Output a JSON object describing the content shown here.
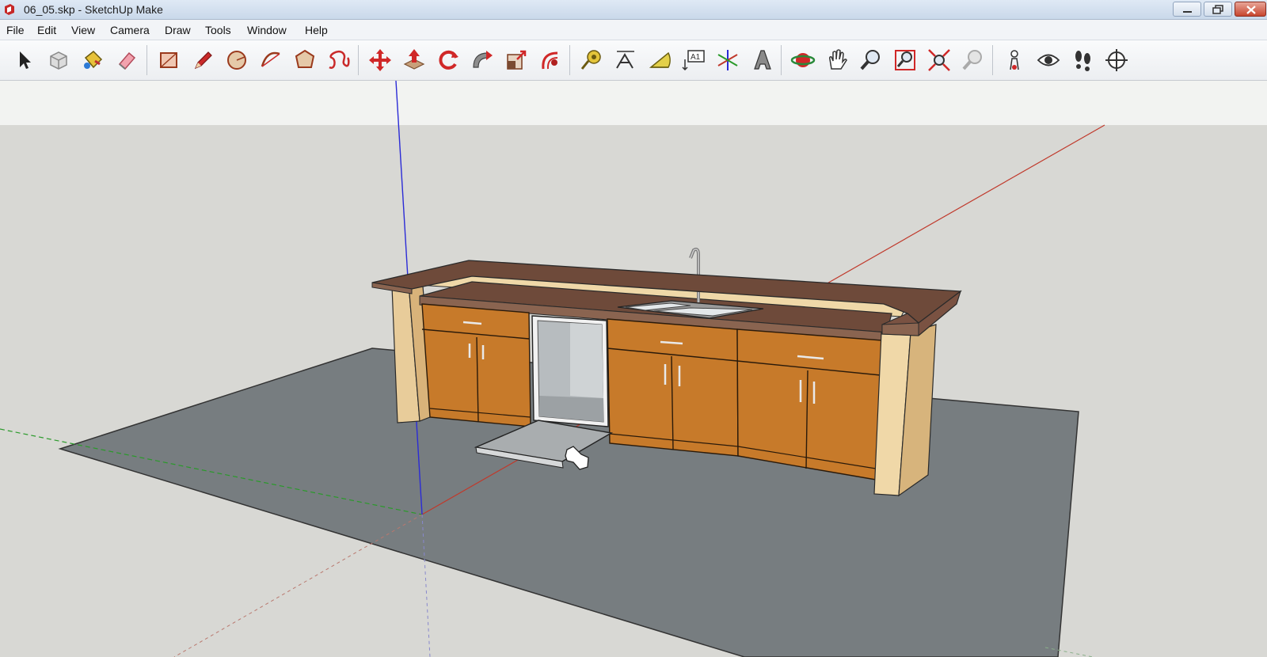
{
  "window": {
    "title": "06_05.skp - SketchUp Make"
  },
  "menu": [
    "File",
    "Edit",
    "View",
    "Camera",
    "Draw",
    "Tools",
    "Window",
    "Help"
  ],
  "toolbar": {
    "tools": [
      {
        "name": "select-tool",
        "icon": "arrow-cursor-icon"
      },
      {
        "name": "make-component-tool",
        "icon": "component-icon"
      },
      {
        "name": "paint-bucket-tool",
        "icon": "paint-bucket-icon"
      },
      {
        "name": "eraser-tool",
        "icon": "eraser-icon"
      },
      {
        "name": "rectangle-tool",
        "icon": "rectangle-icon"
      },
      {
        "name": "line-tool",
        "icon": "pencil-icon"
      },
      {
        "name": "circle-tool",
        "icon": "circle-icon"
      },
      {
        "name": "arc-tool",
        "icon": "arc-icon"
      },
      {
        "name": "polygon-tool",
        "icon": "polygon-icon"
      },
      {
        "name": "freehand-tool",
        "icon": "freehand-icon"
      },
      {
        "name": "move-tool",
        "icon": "move-icon"
      },
      {
        "name": "push-pull-tool",
        "icon": "push-pull-icon"
      },
      {
        "name": "rotate-tool",
        "icon": "rotate-icon"
      },
      {
        "name": "follow-me-tool",
        "icon": "follow-me-icon"
      },
      {
        "name": "scale-tool",
        "icon": "scale-icon"
      },
      {
        "name": "offset-tool",
        "icon": "offset-icon"
      },
      {
        "name": "tape-measure-tool",
        "icon": "tape-measure-icon"
      },
      {
        "name": "dimension-tool",
        "icon": "dimension-icon"
      },
      {
        "name": "protractor-tool",
        "icon": "protractor-icon"
      },
      {
        "name": "text-tool",
        "icon": "text-icon"
      },
      {
        "name": "axes-tool",
        "icon": "axes-icon"
      },
      {
        "name": "3d-text-tool",
        "icon": "3d-text-icon"
      },
      {
        "name": "orbit-tool",
        "icon": "orbit-icon"
      },
      {
        "name": "pan-tool",
        "icon": "hand-icon"
      },
      {
        "name": "zoom-tool",
        "icon": "zoom-icon"
      },
      {
        "name": "zoom-window-tool",
        "icon": "zoom-window-icon"
      },
      {
        "name": "zoom-extents-tool",
        "icon": "zoom-extents-icon"
      },
      {
        "name": "previous-view-tool",
        "icon": "previous-view-icon"
      },
      {
        "name": "position-camera-tool",
        "icon": "position-camera-icon"
      },
      {
        "name": "look-around-tool",
        "icon": "eye-icon"
      },
      {
        "name": "walk-tool",
        "icon": "footprints-icon"
      },
      {
        "name": "section-plane-tool",
        "icon": "section-plane-icon"
      }
    ]
  },
  "colors": {
    "cabinet_wood": "#c77a2a",
    "countertop": "#6a4537",
    "sky": "#f2f3f1",
    "ground": "#d8d8d4",
    "floor_slab": "#777d80",
    "axis_red": "#c0392b",
    "axis_green": "#2a9a2a",
    "axis_blue": "#2b2bd6"
  }
}
